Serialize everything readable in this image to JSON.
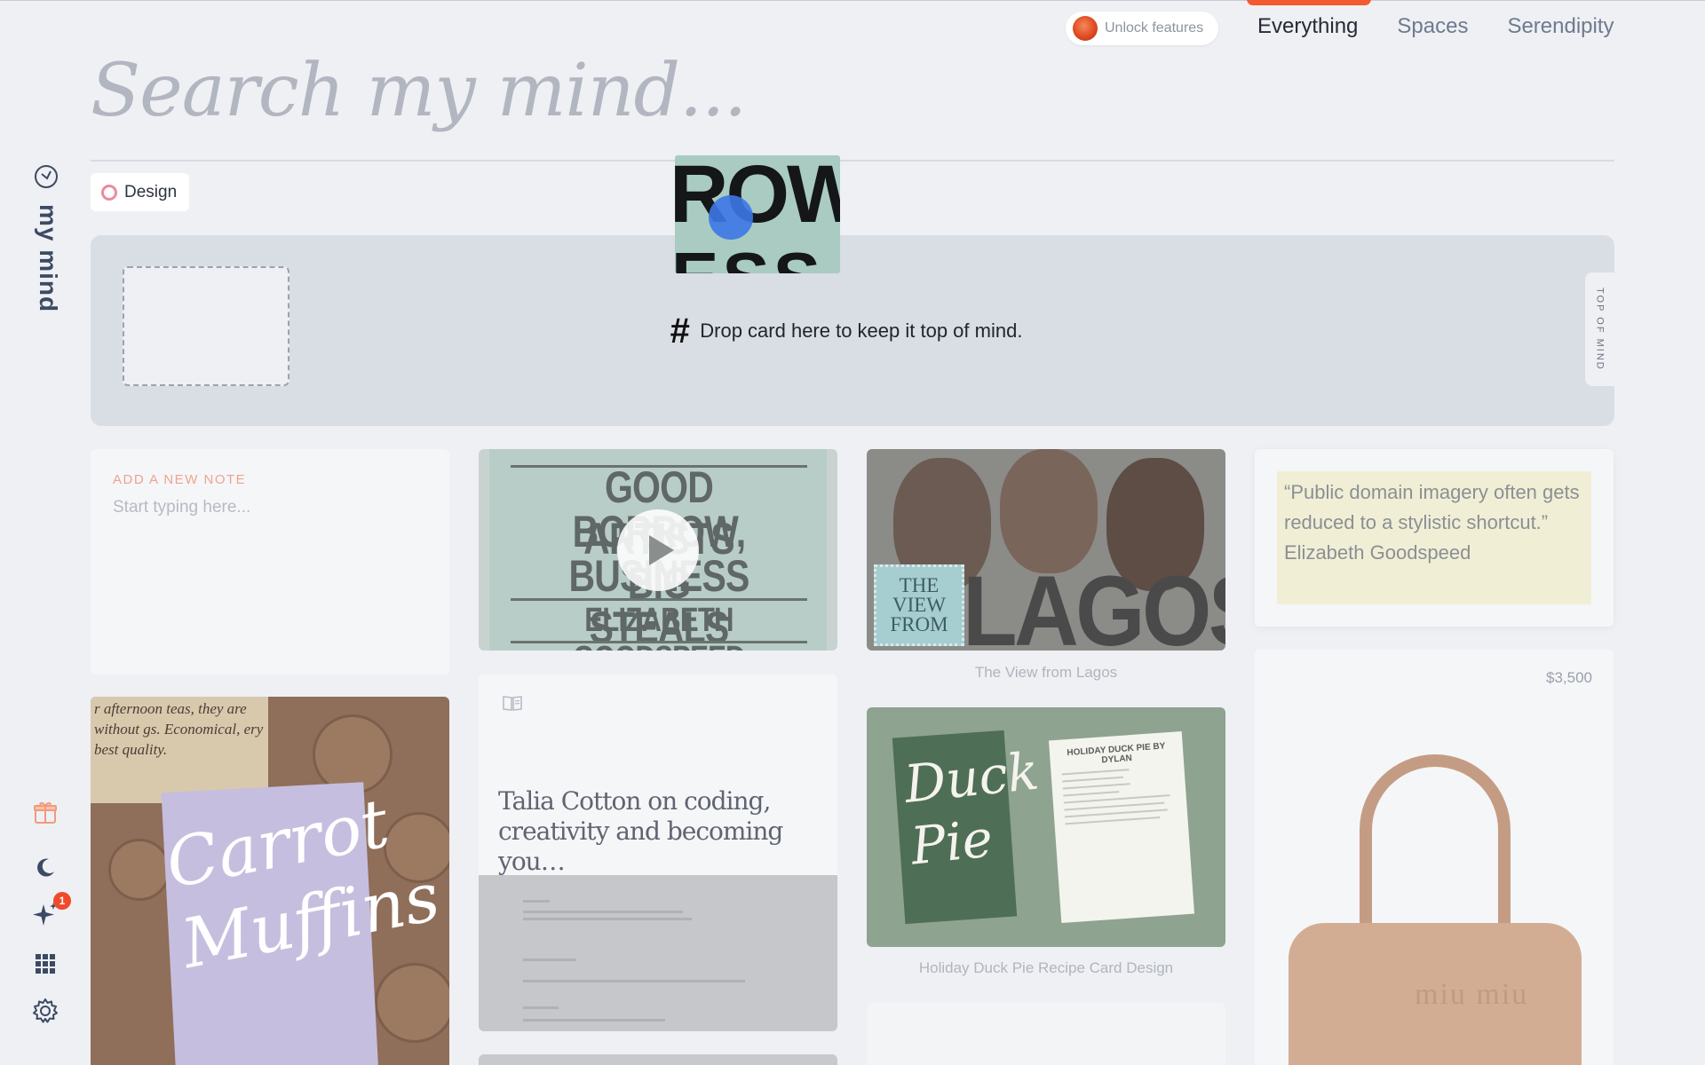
{
  "top_nav": {
    "unlock_label": "Unlock features",
    "tabs": [
      {
        "label": "Everything",
        "active": true
      },
      {
        "label": "Spaces",
        "active": false
      },
      {
        "label": "Serendipity",
        "active": false
      }
    ]
  },
  "search": {
    "placeholder": "Search my mind..."
  },
  "filter_chip": {
    "label": "Design",
    "color": "#ee8a9c"
  },
  "top_of_mind": {
    "drop_message": "Drop card here to keep it top of mind.",
    "side_tab": "TOP OF MIND"
  },
  "sidebar": {
    "brand": "my mind",
    "icons": [
      "brain-icon",
      "gift-icon",
      "moon-icon",
      "sparkle-icon",
      "grid-icon",
      "gear-icon"
    ],
    "sparkle_badge": "1"
  },
  "drag_preview": {
    "text_top": "ROW",
    "text_bottom": "ESS"
  },
  "cards": {
    "note": {
      "label": "ADD A NEW NOTE",
      "placeholder": "Start typing here..."
    },
    "video": {
      "lines": [
        "GOOD ARTISTS",
        "BORROW, BIG",
        "BUSINESS STEALS",
        "ELIZABETH GOODSPEED"
      ]
    },
    "lagos": {
      "tag_lines": [
        "THE",
        "VIEW",
        "FROM"
      ],
      "big_text": "LAGOS",
      "caption": "The View from Lagos"
    },
    "quote": {
      "text": "“Public domain imagery often gets reduced to a stylistic shortcut.”",
      "author": "Elizabeth Goodspeed"
    },
    "muffin": {
      "ad_text": "r afternoon teas, they are without gs. Economical, ery best quality.",
      "title_lines": [
        "Carrot",
        "Muffins"
      ]
    },
    "article": {
      "title": "Talia Cotton on coding, creativity and becoming you…"
    },
    "duck": {
      "green_lines": [
        "Duck",
        "Pie"
      ],
      "recipe_title": "HOLIDAY DUCK PIE BY DYLAN",
      "caption": "Holiday Duck Pie Recipe Card Design"
    },
    "bag": {
      "price": "$3,500",
      "logo": "miu miu"
    }
  },
  "colors": {
    "accent": "#f25a2f",
    "background": "#eef0f4",
    "top_of_mind_bg": "#d9dde4",
    "note_label": "#f0a38c",
    "quote_highlight": "#f0efd6"
  }
}
